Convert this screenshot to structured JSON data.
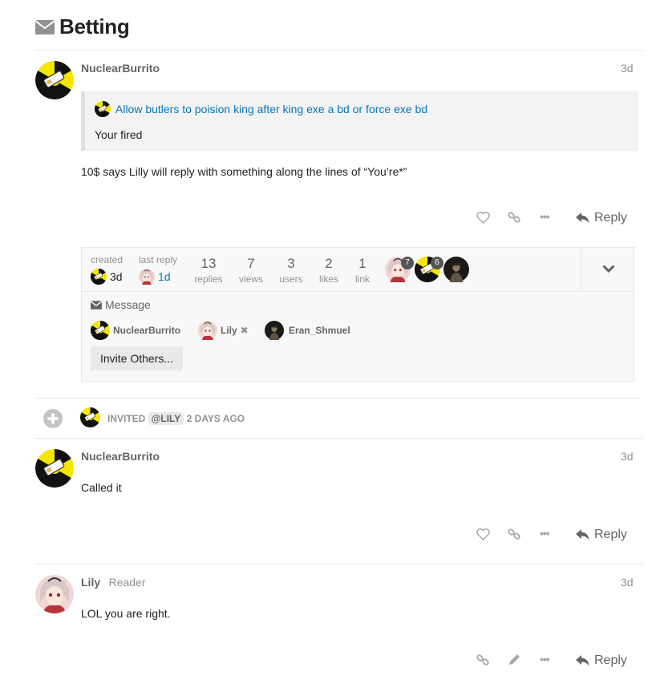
{
  "topic": {
    "title": "Betting"
  },
  "posts": [
    {
      "author": "NuclearBurrito",
      "role": "",
      "date": "3d",
      "quote": {
        "link": "Allow butlers to poision king after king exe a bd or force exe bd",
        "text": "Your fired"
      },
      "body": "10$ says Lilly will reply with something along the lines of “You’re*”",
      "reply_label": "Reply"
    },
    {
      "author": "NuclearBurrito",
      "role": "",
      "date": "3d",
      "body": "Called it",
      "reply_label": "Reply"
    },
    {
      "author": "Lily",
      "role": "Reader",
      "date": "3d",
      "body": "LOL you are right.",
      "reply_label": "Reply"
    }
  ],
  "topic_map": {
    "created_label": "created",
    "created_value": "3d",
    "last_reply_label": "last reply",
    "last_reply_value": "1d",
    "stats": [
      {
        "num": "13",
        "label": "replies"
      },
      {
        "num": "7",
        "label": "views"
      },
      {
        "num": "3",
        "label": "users"
      },
      {
        "num": "2",
        "label": "likes"
      },
      {
        "num": "1",
        "label": "link"
      }
    ],
    "avatar_counts": [
      "7",
      "6"
    ],
    "message_label": "Message",
    "participants": [
      {
        "name": "NuclearBurrito",
        "removable": false
      },
      {
        "name": "Lily",
        "removable": true
      },
      {
        "name": "Eran_Shmuel",
        "removable": false
      }
    ],
    "invite_label": "Invite Others..."
  },
  "small_action": {
    "text": "INVITED",
    "mention": "@LILY",
    "when": "2 DAYS AGO"
  },
  "colors": {
    "link": "#0a75b5",
    "muted": "#919191",
    "nuclear_yellow": "#f5e600"
  },
  "icons": [
    "envelope-icon",
    "heart-icon",
    "link-icon",
    "ellipsis-icon",
    "reply-icon",
    "chevron-down-icon",
    "plus-circle-icon",
    "pencil-icon",
    "remove-icon"
  ]
}
